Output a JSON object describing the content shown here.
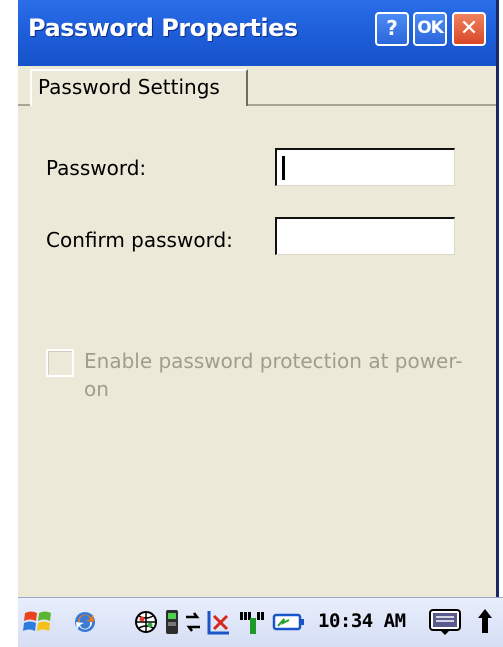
{
  "window": {
    "title": "Password Properties",
    "help_label": "?",
    "ok_label": "OK",
    "close_label": "✕"
  },
  "tabs": [
    {
      "label": "Password Settings",
      "selected": true
    }
  ],
  "form": {
    "password_label": "Password:",
    "password_value": "",
    "confirm_label": "Confirm password:",
    "confirm_value": "",
    "enable_protection_label": "Enable password protection at power-on",
    "enable_protection_checked": false,
    "enable_protection_disabled": true
  },
  "taskbar": {
    "clock": "10:34 AM",
    "icons": [
      "start-icon",
      "sync-icon",
      "network-globe-icon",
      "connection-icon",
      "no-connection-icon",
      "signal-strength-icon",
      "battery-icon",
      "input-panel-icon",
      "up-arrow-icon"
    ]
  },
  "colors": {
    "titlebar": "#1f5fdb",
    "body_bg": "#ece9d8",
    "disabled_text": "#a19d8c",
    "close_button": "#d9472a"
  }
}
